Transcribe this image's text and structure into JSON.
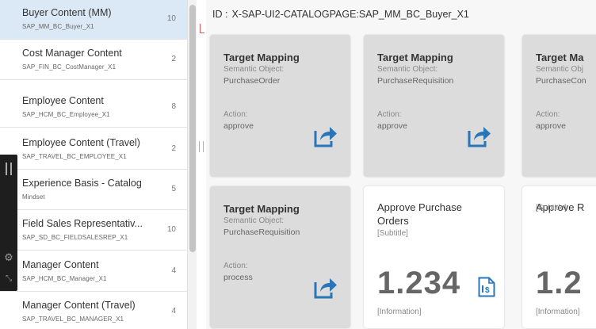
{
  "catalogs": [
    {
      "title": "Buyer Content (MM)",
      "id": "SAP_MM_BC_Buyer_X1",
      "count": "10"
    },
    {
      "title": "Cost Manager Content",
      "id": "SAP_FIN_BC_CostManager_X1",
      "count": "2"
    },
    {
      "title": "Employee Content",
      "id": "SAP_HCM_BC_Employee_X1",
      "count": "8"
    },
    {
      "title": "Employee Content (Travel)",
      "id": "SAP_TRAVEL_BC_EMPLOYEE_X1",
      "count": "2"
    },
    {
      "title": "Experience Basis - Catalog",
      "id": "Mindset",
      "count": "5"
    },
    {
      "title": "Field Sales Representativ...",
      "id": "SAP_SD_BC_FIELDSALESREP_X1",
      "count": "10"
    },
    {
      "title": "Manager Content",
      "id": "SAP_HCM_BC_Manager_X1",
      "count": "4"
    },
    {
      "title": "Manager Content (Travel)",
      "id": "SAP_TRAVEL_BC_MANAGER_X1",
      "count": "4"
    }
  ],
  "detail": {
    "id_label": "ID :",
    "id_value": "X-SAP-UI2-CATALOGPAGE:SAP_MM_BC_Buyer_X1"
  },
  "tiles": [
    {
      "type": "target-mapping",
      "title": "Target Mapping",
      "semantic_label": "Semantic Object:",
      "semantic_object": "PurchaseOrder",
      "action_label": "Action:",
      "action": "approve",
      "icon": "share-icon"
    },
    {
      "type": "target-mapping",
      "title": "Target Mapping",
      "semantic_label": "Semantic Object:",
      "semantic_object": "PurchaseRequisition",
      "action_label": "Action:",
      "action": "approve",
      "icon": "share-icon"
    },
    {
      "type": "target-mapping",
      "title": "Target Ma",
      "semantic_label": "Semantic Obj",
      "semantic_object": "PurchaseCon",
      "action_label": "Action:",
      "action": "approve"
    },
    {
      "type": "target-mapping",
      "title": "Target Mapping",
      "semantic_label": "Semantic Object:",
      "semantic_object": "PurchaseRequisition",
      "action_label": "Action:",
      "action": "process",
      "icon": "share-icon"
    },
    {
      "type": "app",
      "title": "Approve Purchase Orders",
      "subtitle": "[Subtitle]",
      "number": "1.234",
      "info": "[Information]",
      "icon": "document-currency-icon"
    },
    {
      "type": "app",
      "title": "Approve R",
      "subtitle": "[Subtitle]",
      "number": "1.2",
      "info": "[Information]"
    }
  ],
  "colors": {
    "selected_row": "#dbe9f7",
    "icon_blue": "#2a75b8",
    "tile_gray": "#dcdcdc",
    "toolbar_dark": "#1e1e1e"
  }
}
